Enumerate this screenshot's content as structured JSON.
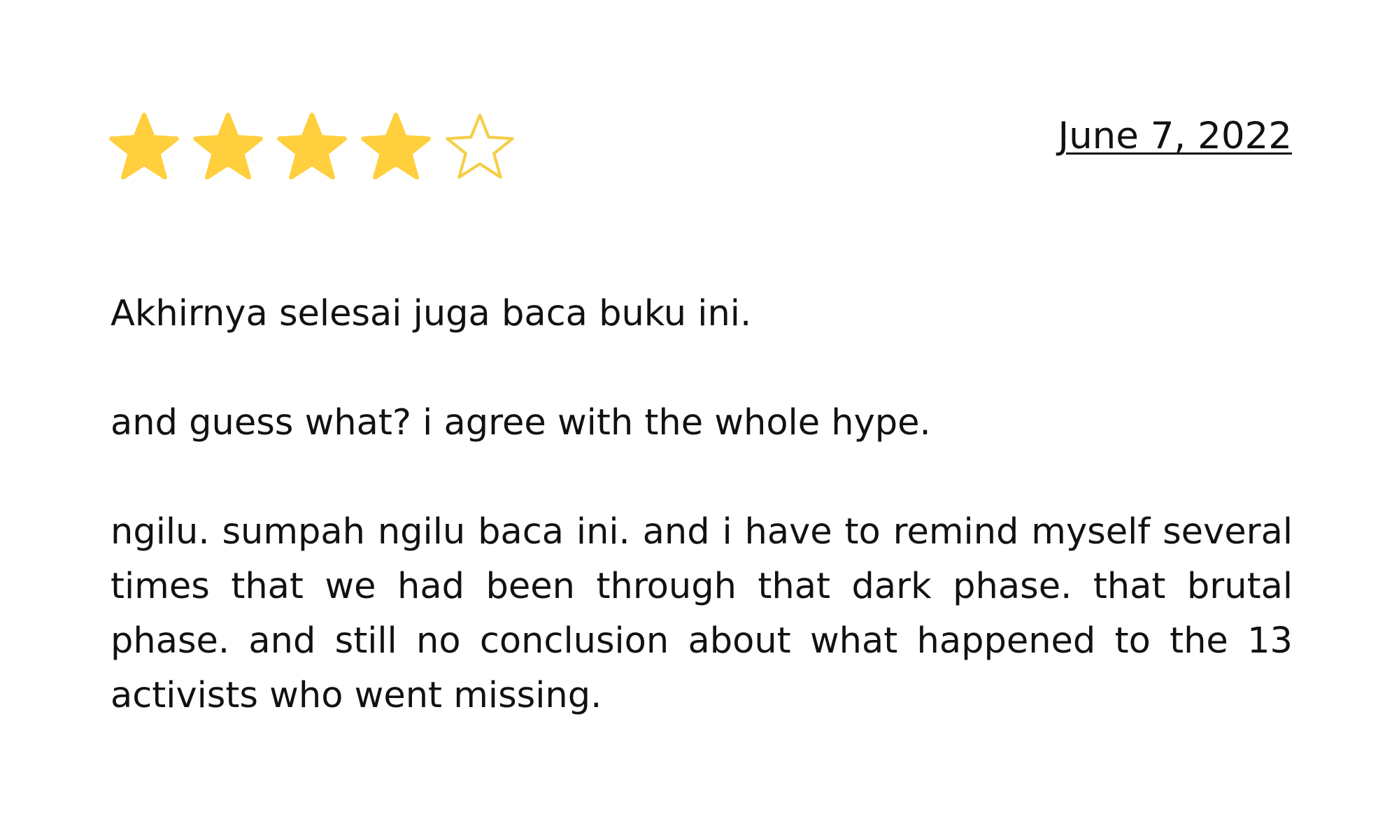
{
  "review": {
    "rating": {
      "value": 4,
      "max": 5,
      "filled_color": "#FFCF3D",
      "empty_stroke_color": "#F5CF4A",
      "stars": [
        {
          "icon": "star-filled-icon",
          "filled": true
        },
        {
          "icon": "star-filled-icon",
          "filled": true
        },
        {
          "icon": "star-filled-icon",
          "filled": true
        },
        {
          "icon": "star-filled-icon",
          "filled": true
        },
        {
          "icon": "star-outline-icon",
          "filled": false
        }
      ]
    },
    "date": "June 7, 2022",
    "paragraphs": [
      "Akhirnya selesai juga baca buku ini.",
      "and guess what? i agree with the whole hype.",
      "ngilu. sumpah ngilu baca ini. and i have to remind myself several times that we had been through that dark phase. that brutal phase. and still no conclusion about what happened to the 13 activists who went missing."
    ]
  }
}
